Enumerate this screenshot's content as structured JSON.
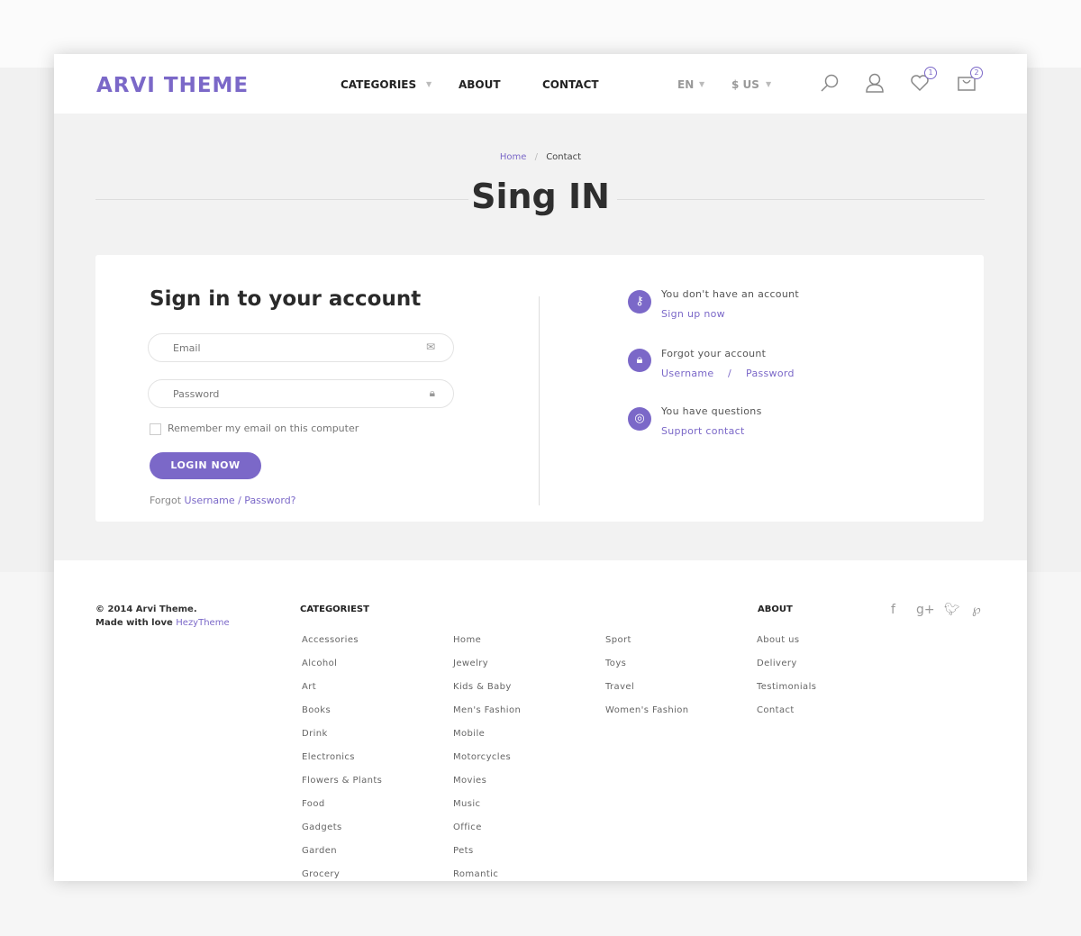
{
  "header": {
    "logo": "ARVI THEME",
    "nav": [
      "CATEGORIES",
      "ABOUT",
      "CONTACT"
    ],
    "language": "EN",
    "currency": "$ US",
    "wishlist_count": "1",
    "cart_count": "2"
  },
  "breadcrumb": {
    "home": "Home",
    "separator": "/",
    "current": "Contact"
  },
  "page_title": "Sing IN",
  "login": {
    "heading": "Sign in to your account",
    "email_placeholder": "Email",
    "password_placeholder": "Password",
    "remember": "Remember my email on this computer",
    "button": "LOGIN NOW",
    "forgot_prefix": "Forgot",
    "forgot_username": "Username / Password?"
  },
  "side": [
    {
      "icon": "key-icon",
      "title": "You don't have an account",
      "links": [
        "Sign up now"
      ]
    },
    {
      "icon": "lock-icon",
      "title": "Forgot your account",
      "links": [
        "Username",
        "Password"
      ],
      "separator": "/"
    },
    {
      "icon": "lifebuoy-icon",
      "title": "You have questions",
      "links": [
        "Support contact"
      ]
    }
  ],
  "footer": {
    "copyright": "© 2014 Arvi Theme.",
    "made_with": "Made with love",
    "made_by": "HezyTheme",
    "categories_heading": "CATEGORIEST",
    "about_heading": "ABOUT",
    "col1": [
      "Accessories",
      "Alcohol",
      "Art",
      "Books",
      "Drink",
      "Electronics",
      "Flowers & Plants",
      "Food",
      "Gadgets",
      "Garden",
      "Grocery"
    ],
    "col2": [
      "Home",
      "Jewelry",
      "Kids & Baby",
      "Men's Fashion",
      "Mobile",
      "Motorcycles",
      "Movies",
      "Music",
      "Office",
      "Pets",
      "Romantic"
    ],
    "col3": [
      "Sport",
      "Toys",
      "Travel",
      "Women's Fashion"
    ],
    "about": [
      "About us",
      "Delivery",
      "Testimonials",
      "Contact"
    ],
    "social": [
      "facebook-icon",
      "google-plus-icon",
      "twitter-icon",
      "pinterest-icon"
    ]
  },
  "colors": {
    "accent": "#7b68c8"
  }
}
